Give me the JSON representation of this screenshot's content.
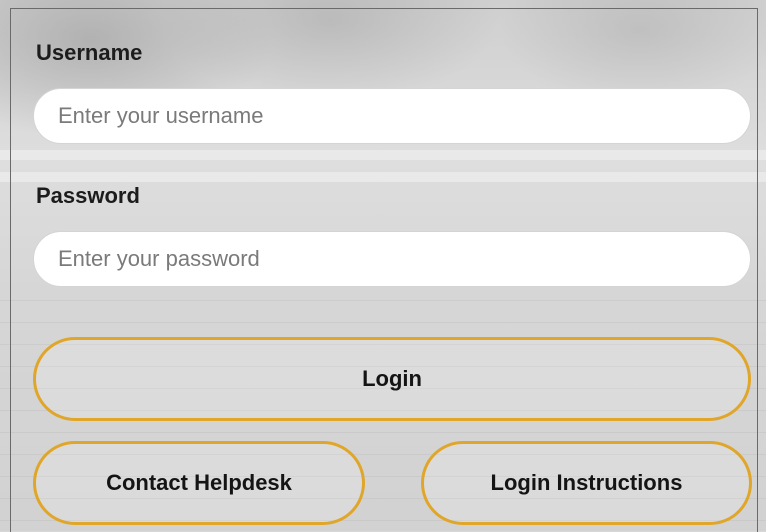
{
  "form": {
    "username": {
      "label": "Username",
      "value": "",
      "placeholder": "Enter your username"
    },
    "password": {
      "label": "Password",
      "value": "",
      "placeholder": "Enter your password"
    }
  },
  "buttons": {
    "login": "Login",
    "contact_helpdesk": "Contact Helpdesk",
    "login_instructions": "Login Instructions"
  },
  "theme": {
    "accent": "#e0a62a",
    "field_background": "#ffffff",
    "label_color": "#1c1c1c"
  }
}
